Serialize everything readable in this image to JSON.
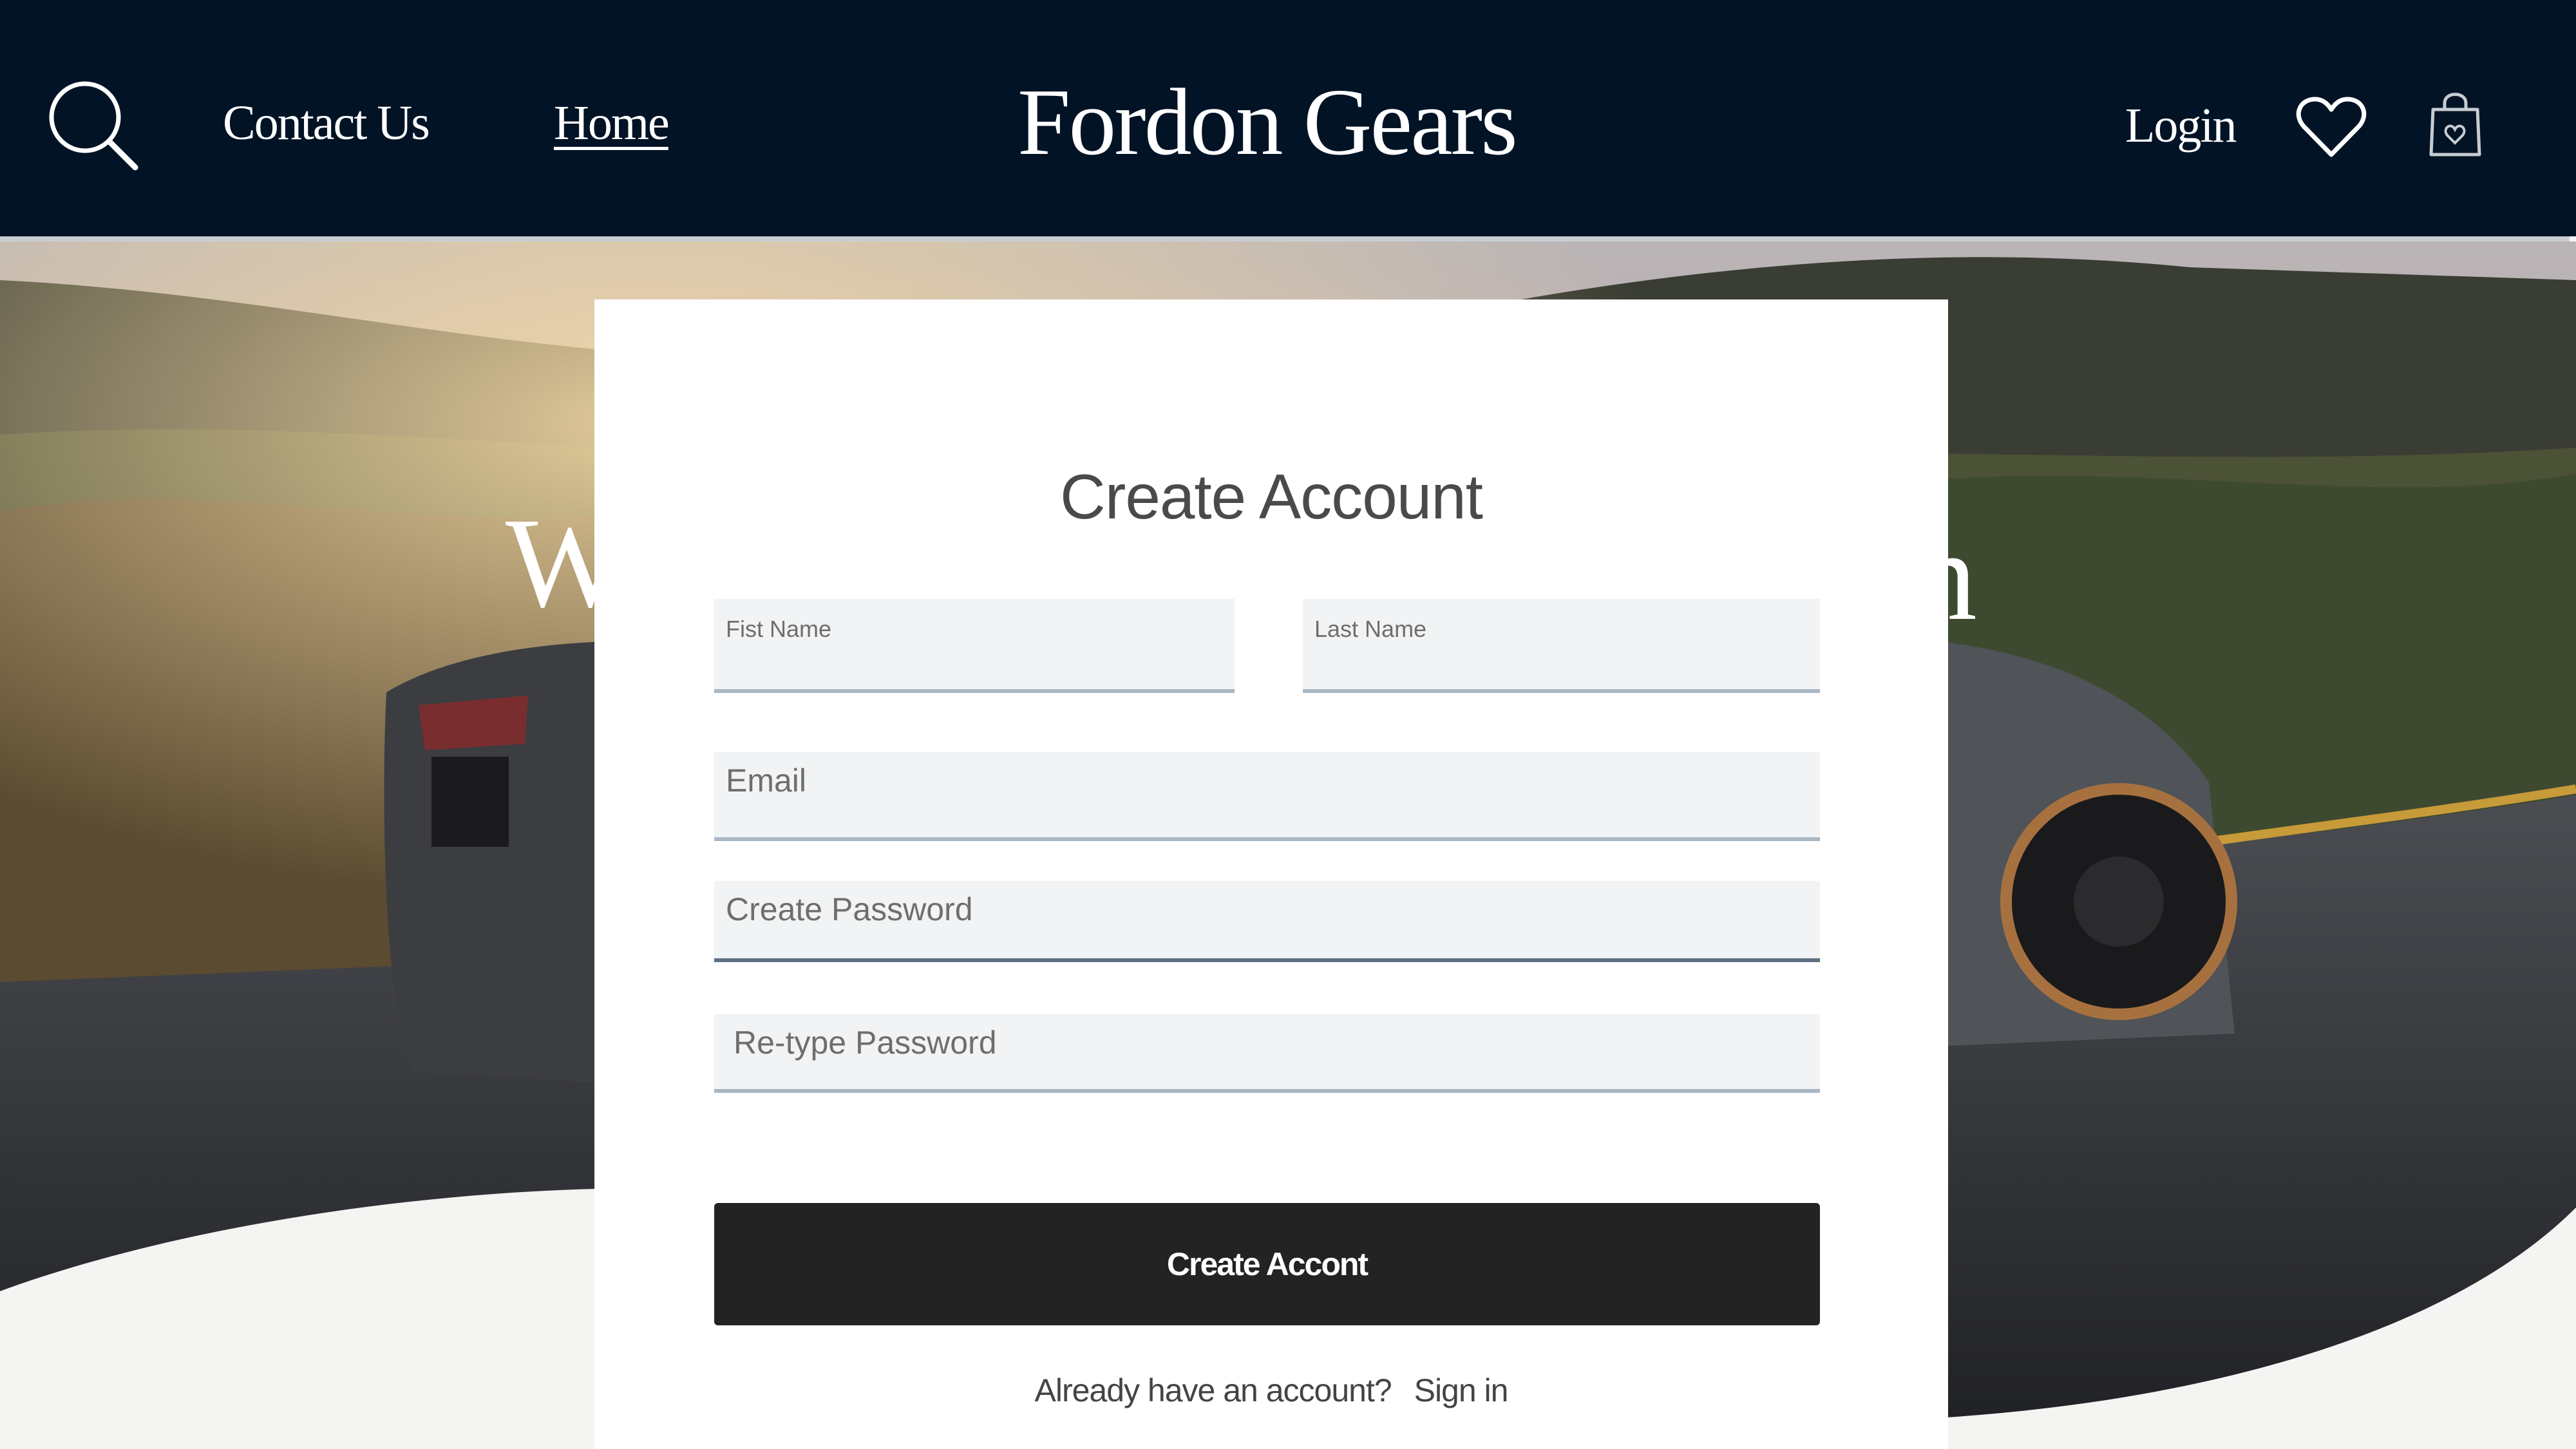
{
  "header": {
    "nav": {
      "contact": "Contact Us",
      "home": "Home",
      "login": "Login"
    },
    "brand": "Fordon Gears",
    "icons": [
      "search-icon",
      "heart-icon",
      "shopping-bag-icon"
    ]
  },
  "hero": {
    "partial_word_left": "W",
    "partial_word_right": "n"
  },
  "form": {
    "title": "Create Account",
    "first_name_placeholder": "Fist Name",
    "last_name_placeholder": "Last Name",
    "email_placeholder": "Email",
    "password_placeholder": "Create Password",
    "retype_placeholder": "Re-type Password",
    "submit_label": "Create Accont",
    "signin_prompt": "Already have an account?",
    "signin_link": "Sign in"
  },
  "colors": {
    "header_bg": "#021326",
    "button_bg": "#232323",
    "field_bg": "#f1f3f4",
    "field_underline": "#a9b7c3"
  }
}
